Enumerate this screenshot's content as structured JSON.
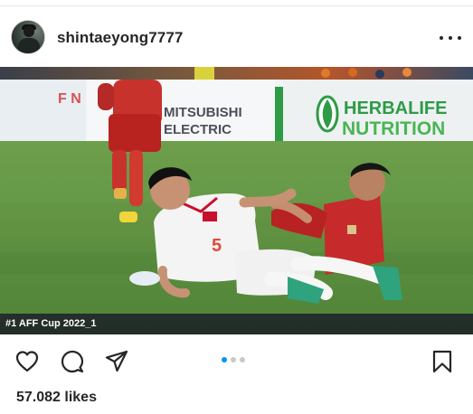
{
  "post": {
    "username": "shintaeyong7777",
    "media": {
      "caption_overlay": "#1 AFF Cup 2022_1",
      "ad_boards": {
        "left_fragment": "F N",
        "mitsubishi": [
          "MITSUBISHI",
          "ELECTRIC"
        ],
        "herbalife": [
          "HERBALIFE",
          "NUTRITION"
        ]
      },
      "jersey_number": "5"
    },
    "carousel": {
      "total": 3,
      "active_index": 0
    },
    "likes_text": "57.082 likes"
  },
  "icons": {
    "more": "more-options-icon",
    "like": "heart-icon",
    "comment": "comment-bubble-icon",
    "share": "paper-plane-icon",
    "save": "bookmark-icon"
  },
  "colors": {
    "text": "#262626",
    "carousel_active": "#0095f6",
    "carousel_inactive": "#c9c9c9",
    "pitch_green": "#5a8f3f",
    "herbalife_green": "#2e9b47",
    "vietnam_red": "#c8102e",
    "indonesia_red": "#c62a2a"
  }
}
